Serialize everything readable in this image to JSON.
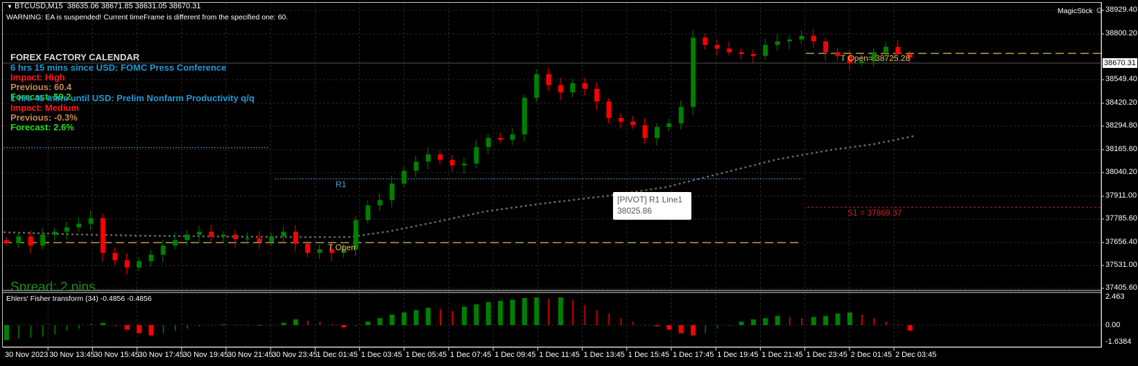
{
  "header": {
    "symbol": "BTCUSD,M15",
    "ohlc": "38635.06 38671.85 38631.05 38670.31",
    "warning": "WARNING: EA is suspended! Current timeFrame is different from the specified one: 60.",
    "magicstick": "MagicStick",
    "smiley": "☺"
  },
  "calendar": {
    "title": "FOREX FACTORY CALENDAR",
    "event1": "6 hrs 15 mins since USD: FOMC Press Conference",
    "impact1": "Impact: High",
    "previous1": "Previous: 60.4",
    "forecast1": "Forecast: 59.2",
    "event2": "1 hrs 45 mins until USD: Prelim Nonfarm Productivity q/q",
    "impact2": "Impact: Medium",
    "previous2": "Previous: -0.3%",
    "forecast2": "Forecast: 2.6%"
  },
  "spread": "Spread: 2 pins",
  "levels": {
    "r1": "R1",
    "t_open": "T Open",
    "t_open_top": "T Open= 38725.28",
    "s1": "S1 = 37869.37"
  },
  "tooltip": {
    "line1": "[PIVOT] R1  Line1",
    "line2": "38025.86"
  },
  "current_price": "38670.31",
  "price_axis": [
    "38929.40",
    "38800.20",
    "38549.40",
    "38420.20",
    "38294.80",
    "38165.60",
    "38040.20",
    "37911.00",
    "37785.60",
    "37656.40",
    "37531.00",
    "37405.60"
  ],
  "indicator": {
    "label": "Ehlers' Fisher transform (34) -0.4856 -0.4856",
    "axis": [
      "2.463",
      "0.00",
      "-1.6384"
    ]
  },
  "time_axis": [
    "30 Nov 2023",
    "30 Nov 13:45",
    "30 Nov 15:45",
    "30 Nov 17:45",
    "30 Nov 19:45",
    "30 Nov 21:45",
    "30 Nov 23:45",
    "1 Dec 01:45",
    "1 Dec 03:45",
    "1 Dec 05:45",
    "1 Dec 07:45",
    "1 Dec 09:45",
    "1 Dec 11:45",
    "1 Dec 13:45",
    "1 Dec 15:45",
    "1 Dec 17:45",
    "1 Dec 19:45",
    "1 Dec 21:45",
    "1 Dec 23:45",
    "2 Dec 01:45",
    "2 Dec 03:45"
  ],
  "colors": {
    "bull": "#008000",
    "bear": "#ff0000",
    "calendar_blue": "#1e9ad6",
    "impact_red": "#ff1a1a",
    "previous": "#c98a50",
    "forecast": "#22dd22",
    "t_open": "#e6c060",
    "r1": "#4aa6d8",
    "s1": "#cc2222"
  },
  "chart_data": {
    "type": "candlestick",
    "price_range": [
      37405.6,
      38929.4
    ],
    "close": [
      37655,
      37690,
      37640,
      37700,
      37716,
      37740,
      37760,
      37790,
      37600,
      37560,
      37520,
      37555,
      37590,
      37640,
      37670,
      37700,
      37716,
      37690,
      37700,
      37676,
      37680,
      37660,
      37690,
      37716,
      37650,
      37600,
      37620,
      37600,
      37620,
      37780,
      37860,
      37890,
      37980,
      38050,
      38100,
      38140,
      38110,
      38080,
      38090,
      38180,
      38230,
      38220,
      38250,
      38450,
      38580,
      38520,
      38480,
      38530,
      38500,
      38430,
      38340,
      38320,
      38300,
      38230,
      38290,
      38310,
      38400,
      38780,
      38740,
      38720,
      38700,
      38690,
      38680,
      38740,
      38760,
      38770,
      38790,
      38760,
      38700,
      38680,
      38640,
      38650,
      38700,
      38730,
      38690,
      38670.31
    ],
    "fisher": [
      -1.3,
      -1.2,
      -1.1,
      -1.0,
      -0.8,
      -0.5,
      -0.3,
      0.15,
      0.2,
      -0.1,
      -0.4,
      -0.7,
      -0.9,
      -0.7,
      -0.5,
      -0.3,
      -0.1,
      0.02,
      0.05,
      0.03,
      0.02,
      0.02,
      0.01,
      0.2,
      0.5,
      0.4,
      0.3,
      0.1,
      -0.2,
      -0.1,
      0.3,
      0.6,
      0.9,
      1.1,
      1.3,
      1.5,
      1.4,
      1.2,
      1.6,
      1.8,
      2.0,
      2.1,
      2.2,
      2.35,
      2.4,
      2.3,
      2.4,
      2.2,
      1.7,
      1.3,
      1.0,
      0.6,
      0.3,
      0.0,
      -0.1,
      -0.4,
      -0.7,
      -0.9,
      -0.7,
      -0.3,
      0.0,
      0.3,
      0.5,
      0.6,
      0.8,
      0.7,
      0.6,
      0.7,
      0.8,
      1.0,
      1.1,
      0.9,
      0.6,
      0.3,
      0.0,
      -0.4856
    ],
    "fisher_range": [
      -1.6384,
      2.463
    ]
  }
}
